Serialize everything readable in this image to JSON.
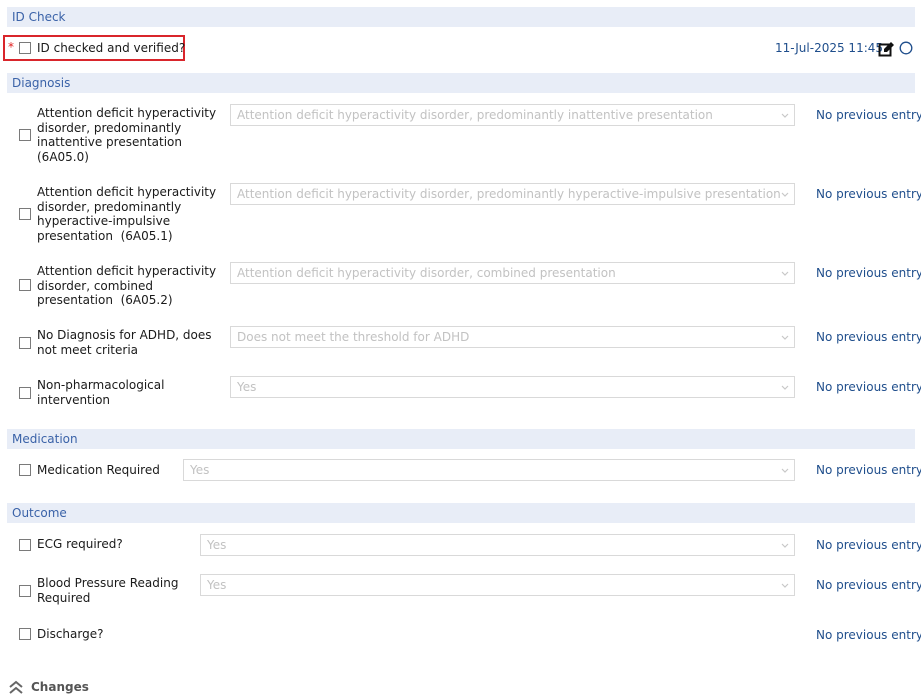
{
  "sections": {
    "id_check": "ID Check",
    "diagnosis": "Diagnosis",
    "medication": "Medication",
    "outcome": "Outcome"
  },
  "id_check": {
    "required_marker": "*",
    "label": "ID checked and verified?",
    "timestamp": "11-Jul-2025 11:45"
  },
  "diagnosis": {
    "rows": [
      {
        "label": "Attention deficit hyperactivity disorder, predominantly inattentive presentation (6A05.0)",
        "lines": [
          "Attention deficit hyperactivity",
          "disorder, predominantly",
          "inattentive presentation",
          "(6A05.0)"
        ],
        "dropdown": "Attention deficit hyperactivity disorder, predominantly inattentive presentation",
        "prev": "No previous entry"
      },
      {
        "label": "Attention deficit hyperactivity disorder, predominantly hyperactive-impulsive presentation (6A05.1)",
        "lines": [
          "Attention deficit hyperactivity",
          "disorder, predominantly",
          "hyperactive-impulsive",
          "presentation  (6A05.1)"
        ],
        "dropdown": "Attention deficit hyperactivity disorder, predominantly hyperactive-impulsive presentation",
        "prev": "No previous entry"
      },
      {
        "label": "Attention deficit hyperactivity disorder, combined presentation (6A05.2)",
        "lines": [
          "Attention deficit hyperactivity",
          "disorder, combined",
          "presentation  (6A05.2)"
        ],
        "dropdown": "Attention deficit hyperactivity disorder, combined presentation",
        "prev": "No previous entry"
      },
      {
        "label": "No Diagnosis for ADHD, does not meet criteria",
        "lines": [
          "No Diagnosis for ADHD, does",
          "not meet criteria"
        ],
        "dropdown": "Does not meet the threshold for ADHD",
        "prev": "No previous entry"
      },
      {
        "label": "Non-pharmacological intervention",
        "lines": [
          "Non-pharmacological",
          "intervention"
        ],
        "dropdown": "Yes",
        "prev": "No previous entry"
      }
    ]
  },
  "medication": {
    "label": "Medication Required",
    "dropdown": "Yes",
    "prev": "No previous entry"
  },
  "outcome": {
    "rows": [
      {
        "lines": [
          "ECG required?"
        ],
        "dropdown": "Yes",
        "prev": "No previous entry"
      },
      {
        "lines": [
          "Blood Pressure Reading",
          "Required"
        ],
        "dropdown": "Yes",
        "prev": "No previous entry"
      },
      {
        "lines": [
          "Discharge?"
        ],
        "dropdown": null,
        "prev": "No previous entry"
      }
    ]
  },
  "footer": {
    "changes_label": "Changes"
  },
  "icons": {
    "edit": "edit-note-icon",
    "status": "status-circle-icon",
    "chevron": "chevron-down-icon",
    "collapse": "double-chevron-up-icon"
  },
  "colors": {
    "section_bg": "#e8edf7",
    "section_text": "#3a62a8",
    "link": "#1f4e8c",
    "required": "#e02020",
    "highlight": "#d9252b"
  }
}
